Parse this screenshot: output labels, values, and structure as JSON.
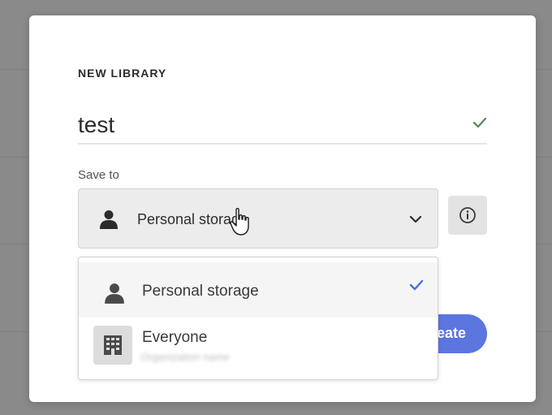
{
  "dialog": {
    "heading": "NEW LIBRARY",
    "name_value": "test",
    "save_to_label": "Save to",
    "selected_storage": "Personal storage",
    "create_button_label": "Create",
    "icons": {
      "valid": "checkmark-icon",
      "user": "user-icon",
      "dropdown": "chevron-down-icon",
      "info": "info-icon",
      "organization": "building-icon",
      "cursor": "hand-cursor-icon"
    }
  },
  "dropdown": {
    "options": [
      {
        "label": "Personal storage",
        "selected": true
      },
      {
        "label": "Everyone",
        "sublabel": "Organization name"
      }
    ]
  },
  "colors": {
    "overlay": "#8a8a8a",
    "accent": "#5c76e0",
    "valid_check": "#4c8b5b",
    "selected_check": "#4b6fdc"
  }
}
